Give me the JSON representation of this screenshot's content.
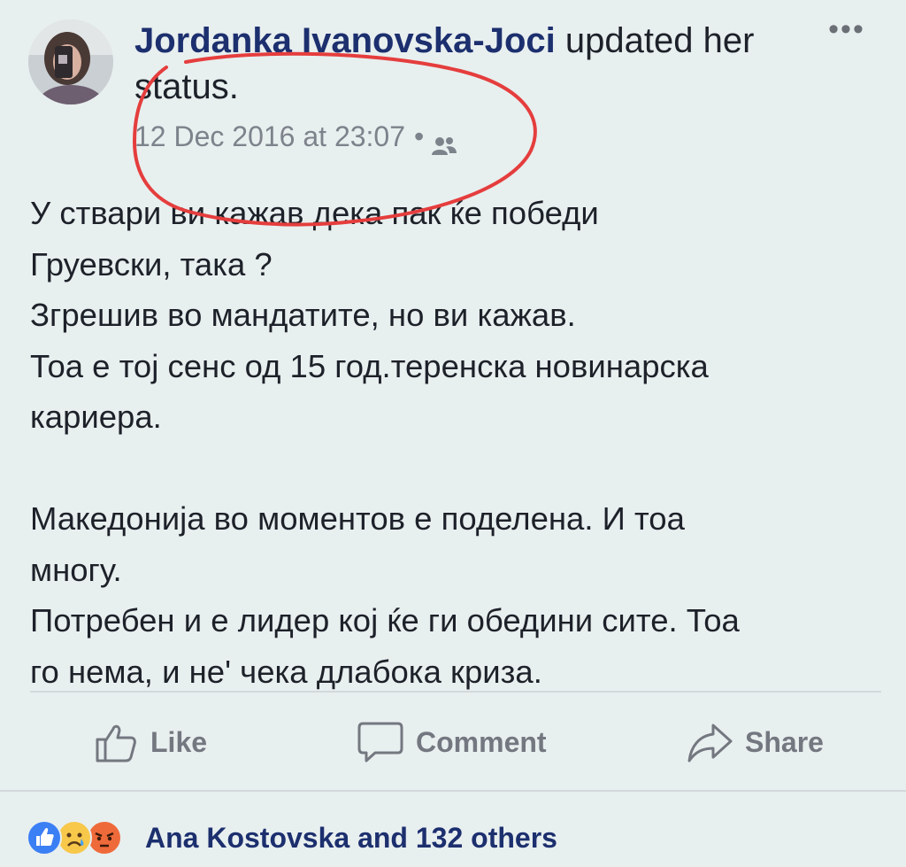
{
  "post": {
    "author_name": "Jordanka Ivanovska-Joci",
    "action_text": "updated her status.",
    "timestamp": "12 Dec 2016 at 23:07",
    "separator": "•",
    "audience_icon": "friends-icon",
    "more_icon": "more-options-icon",
    "more_glyph": "•••",
    "body_paragraphs": [
      "У ствари ви кажав дека пак ќе победи Груевски, така ?\nЗгрешив во мандатите, но ви кажав.\nТоа е тој сенс од 15 год.теренска новинарска кариера.",
      "Македонија во моментов е поделена. И тоа многу.\nПотребен и е лидер кој ќе ги обедини сите. Тоа го нема, и не' чека длабока криза."
    ]
  },
  "actions": {
    "like_label": "Like",
    "comment_label": "Comment",
    "share_label": "Share"
  },
  "reactions": {
    "icons": [
      "like-reaction-icon",
      "sad-reaction-icon",
      "angry-reaction-icon"
    ],
    "summary": "Ana Kostovska and 132 others"
  },
  "colors": {
    "background": "#e8efef",
    "author": "#1c2f6e",
    "meta": "#7d838b",
    "annotation_red": "#e53d3d",
    "like_blue": "#3b7ff5"
  }
}
